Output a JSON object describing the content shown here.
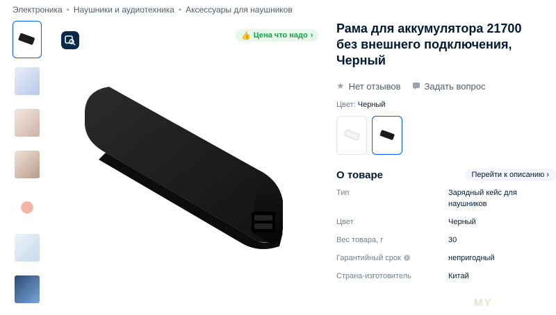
{
  "breadcrumb": [
    "Электроника",
    "Наушники и аудиотехника",
    "Аксессуары для наушников"
  ],
  "thumbnails": [
    {
      "label": "thumb-1",
      "color": "#1c1c1c"
    },
    {
      "label": "thumb-2",
      "color": "#b9c8ea"
    },
    {
      "label": "thumb-3",
      "color": "#e8d6cf"
    },
    {
      "label": "thumb-4",
      "color": "#d9c9bd"
    },
    {
      "label": "thumb-5",
      "color": "#f2b5a8"
    },
    {
      "label": "thumb-6",
      "color": "#c5d9ec"
    },
    {
      "label": "thumb-7",
      "color": "#7aa6d9"
    }
  ],
  "badge": {
    "label": "Цена что надо"
  },
  "product": {
    "title": "Рама для аккумулятора 21700 без внешнего подключения, Черный",
    "reviews": "Нет отзывов",
    "ask": "Задать вопрос",
    "color_label": "Цвет:",
    "color_value": "Черный"
  },
  "about": {
    "title": "О товаре",
    "goto": "Перейти к описанию"
  },
  "specs": [
    {
      "key": "Тип",
      "value": "Зарядный кейс для наушников"
    },
    {
      "key": "Цвет",
      "value": "Черный"
    },
    {
      "key": "Вес товара, г",
      "value": "30"
    },
    {
      "key": "Гарантийный срок",
      "value": "непригодный"
    },
    {
      "key": "Страна-изготовитель",
      "value": "Китай"
    }
  ],
  "watermark": "MY",
  "colors": {
    "accent": "#005bff",
    "badge_bg": "#e8f7ec",
    "badge_fg": "#10a64a",
    "text": "#001a34"
  }
}
